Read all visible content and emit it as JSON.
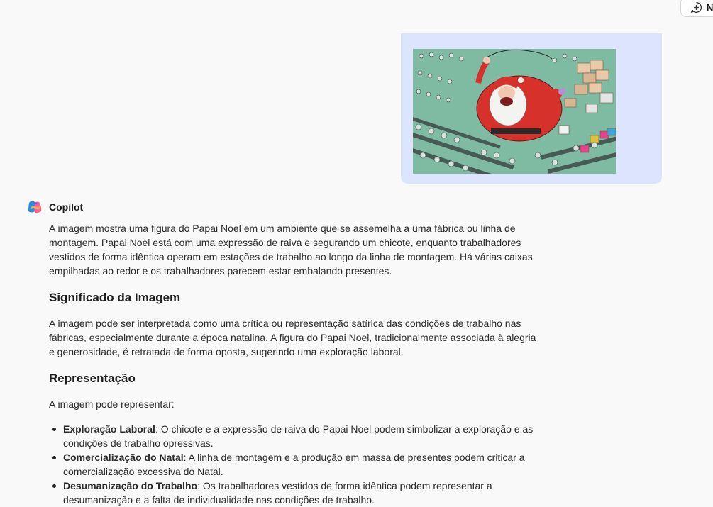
{
  "header": {
    "new_chat_label": "N"
  },
  "user_message": {
    "image_alt": "Papai Noel em uma linha de montagem de fábrica"
  },
  "assistant": {
    "name": "Copilot",
    "intro": "A imagem mostra uma figura do Papai Noel em um ambiente que se assemelha a uma fábrica ou linha de montagem. Papai Noel está com uma expressão de raiva e segurando um chicote, enquanto trabalhadores vestidos de forma idêntica operam em estações de trabalho ao longo da linha de montagem. Há várias caixas empilhadas ao redor e os trabalhadores parecem estar embalando presentes.",
    "heading_1": "Significado da Imagem",
    "paragraph_1": "A imagem pode ser interpretada como uma crítica ou representação satírica das condições de trabalho nas fábricas, especialmente durante a época natalina. A figura do Papai Noel, tradicionalmente associada à alegria e generosidade, é retratada de forma oposta, sugerindo uma exploração laboral.",
    "heading_2": "Representação",
    "paragraph_2": "A imagem pode representar:",
    "bullets": [
      {
        "title": "Exploração Laboral",
        "text": ": O chicote e a expressão de raiva do Papai Noel podem simbolizar a exploração e as condições de trabalho opressivas."
      },
      {
        "title": "Comercialização do Natal",
        "text": ": A linha de montagem e a produção em massa de presentes podem criticar a comercialização excessiva do Natal."
      },
      {
        "title": "Desumanização do Trabalho",
        "text": ": Os trabalhadores vestidos de forma idêntica podem representar a desumanização e a falta de individualidade nas condições de trabalho."
      }
    ]
  },
  "colors": {
    "background": "#f9f9fa",
    "user_bubble": "#dde4fd",
    "text": "#2b2b2b",
    "santa_red": "#d6322b",
    "factory_green": "#6fb59b"
  }
}
